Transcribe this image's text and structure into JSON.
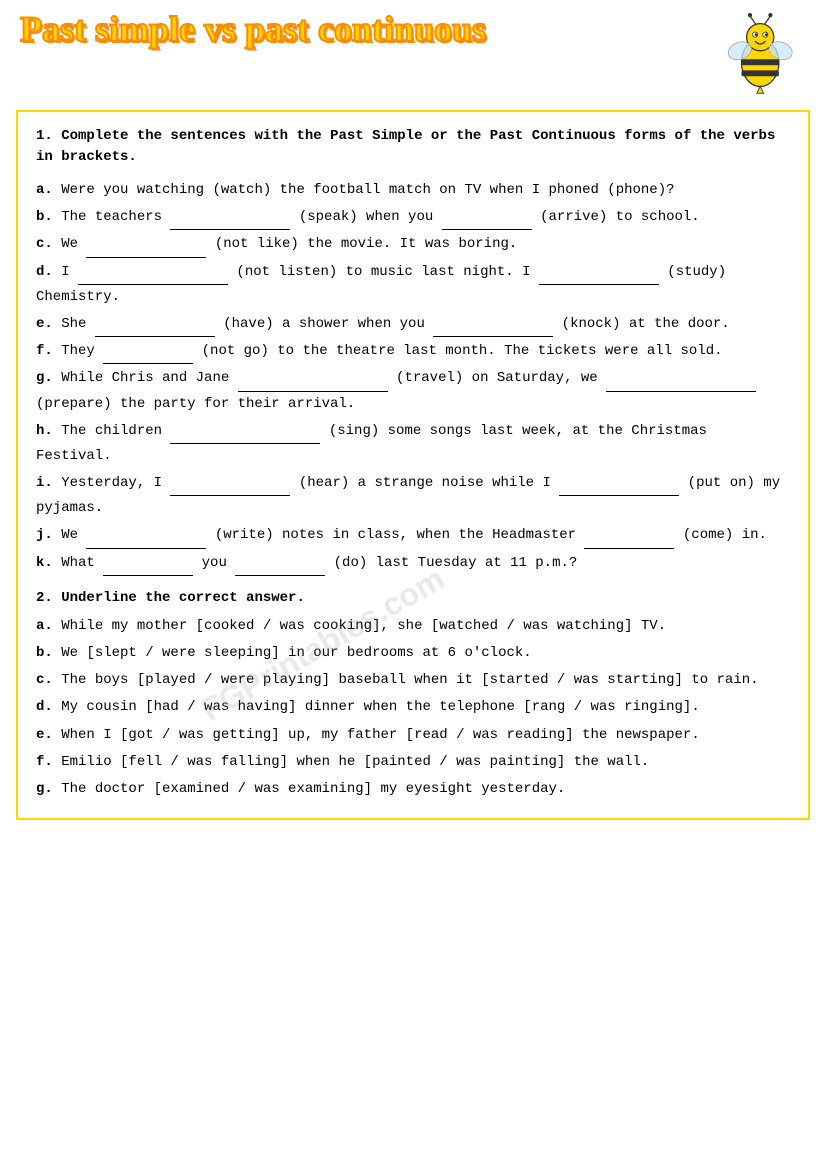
{
  "header": {
    "title": "Past simple vs past continuous"
  },
  "section1": {
    "number": "1.",
    "instruction": "Complete the sentences with the Past Simple or the Past Continuous forms of the verbs in brackets.",
    "sentences": [
      {
        "label": "a.",
        "text": "Were you watching (watch) the football match on TV when I phoned (phone)?"
      },
      {
        "label": "b.",
        "text_parts": [
          "The teachers",
          "(speak) when you",
          "(arrive) to school."
        ]
      },
      {
        "label": "c.",
        "text_parts": [
          "We",
          "(not like) the movie. It was boring."
        ]
      },
      {
        "label": "d.",
        "text_parts": [
          "I",
          "(not listen) to music last night. I",
          "(study) Chemistry."
        ]
      },
      {
        "label": "e.",
        "text_parts": [
          "She",
          "(have) a shower when you",
          "(knock) at the door."
        ]
      },
      {
        "label": "f.",
        "text_parts": [
          "They",
          "(not go) to the theatre last month. The tickets were all sold."
        ]
      },
      {
        "label": "g.",
        "text_parts": [
          "While Chris and Jane",
          "(travel) on Saturday, we",
          "(prepare) the party for their arrival."
        ]
      },
      {
        "label": "h.",
        "text_parts": [
          "The children",
          "(sing) some songs last week, at the Christmas Festival."
        ]
      },
      {
        "label": "i.",
        "text_parts": [
          "Yesterday, I",
          "(hear) a strange noise while I",
          "(put on) my pyjamas."
        ]
      },
      {
        "label": "j.",
        "text_parts": [
          "We",
          "(write) notes in class, when the Headmaster",
          "(come) in."
        ]
      },
      {
        "label": "k.",
        "text_parts": [
          "What",
          "you",
          "(do) last Tuesday at 11 p.m.?"
        ]
      }
    ]
  },
  "section2": {
    "number": "2.",
    "instruction": "Underline the correct answer.",
    "sentences": [
      {
        "label": "a.",
        "text": "While my mother [cooked / was cooking], she [watched / was watching] TV."
      },
      {
        "label": "b.",
        "text": "We [slept / were sleeping] in our bedrooms at 6 o'clock."
      },
      {
        "label": "c.",
        "text": "The boys [played / were playing] baseball when it [started / was starting] to rain."
      },
      {
        "label": "d.",
        "text": "My cousin [had / was having] dinner when the telephone [rang / was ringing]."
      },
      {
        "label": "e.",
        "text": "When I [got / was getting] up, my father [read / was reading] the newspaper."
      },
      {
        "label": "f.",
        "text": "Emilio [fell / was falling] when he [painted / was painting] the wall."
      },
      {
        "label": "g.",
        "text": "The doctor [examined / was examining] my eyesight yesterday."
      }
    ]
  },
  "watermark": "FGPrintables.com"
}
